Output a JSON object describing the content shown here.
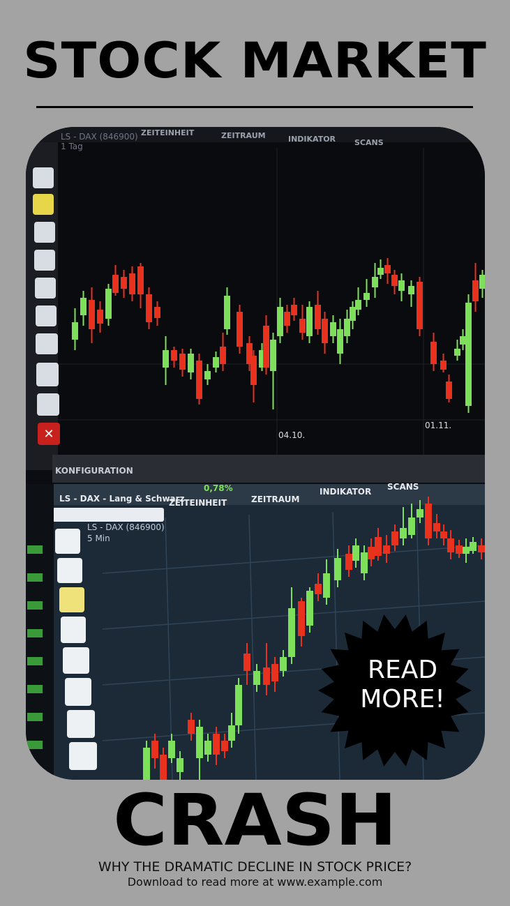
{
  "headline": "STOCK MARKET",
  "cta": "READ MORE!",
  "title_bottom": "CRASH",
  "subheadline": "WHY THE DRAMATIC DECLINE IN STOCK PRICE?",
  "download_text": "Download to read more at www.example.com",
  "colors": {
    "background": "#a3a3a3",
    "text": "#000000",
    "burst_fill": "#000000",
    "burst_text": "#ffffff",
    "candle_up": "#7ee05a",
    "candle_down": "#e8321e"
  },
  "photo": {
    "top_screen": {
      "menu": [
        "ZEITEINHEIT",
        "ZEITRAUM",
        "INDIKATOR",
        "SCANS"
      ],
      "symbol": "LS - DAX (846900)",
      "interval": "1 Tag",
      "dates": [
        "04.10.",
        "01.11."
      ],
      "footer": "KONFIGURATION"
    },
    "bottom_screen": {
      "tab": "LS - DAX - Lang & Schwarz",
      "change": "0,78%",
      "menu": [
        "ZEITEINHEIT",
        "ZEITRAUM",
        "INDIKATOR",
        "SCANS"
      ],
      "symbol": "LS - DAX (846900)",
      "interval": "5 Min"
    }
  }
}
